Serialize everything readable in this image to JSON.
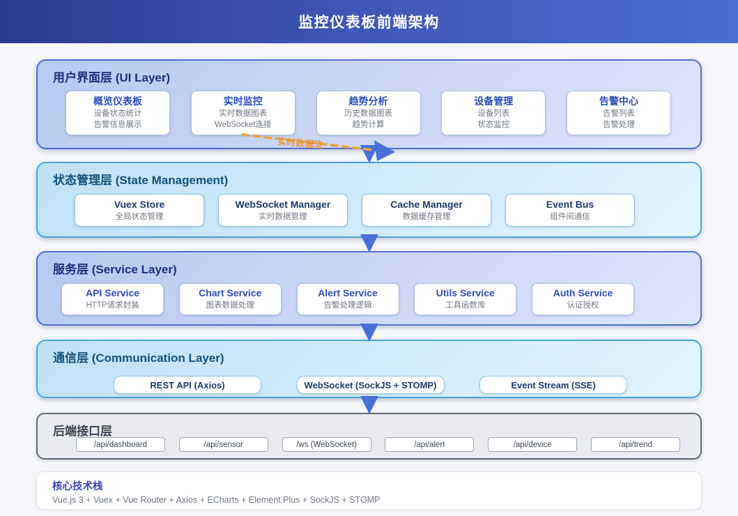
{
  "header": {
    "title": "监控仪表板前端架构"
  },
  "layers": {
    "ui": {
      "title": "用户界面层 (UI Layer)",
      "cards": [
        {
          "title": "概览仪表板",
          "lines": [
            "设备状态统计",
            "告警信息展示"
          ]
        },
        {
          "title": "实时监控",
          "lines": [
            "实时数据图表",
            "WebSocket连接"
          ]
        },
        {
          "title": "趋势分析",
          "lines": [
            "历史数据图表",
            "趋势计算"
          ]
        },
        {
          "title": "设备管理",
          "lines": [
            "设备列表",
            "状态监控"
          ]
        },
        {
          "title": "告警中心",
          "lines": [
            "告警列表",
            "告警处理"
          ]
        }
      ]
    },
    "state": {
      "title": "状态管理层 (State Management)",
      "cards": [
        {
          "title": "Vuex Store",
          "lines": [
            "全局状态管理"
          ]
        },
        {
          "title": "WebSocket Manager",
          "lines": [
            "实时数据管理"
          ]
        },
        {
          "title": "Cache Manager",
          "lines": [
            "数据缓存管理"
          ]
        },
        {
          "title": "Event Bus",
          "lines": [
            "组件间通信"
          ]
        }
      ]
    },
    "service": {
      "title": "服务层 (Service Layer)",
      "cards": [
        {
          "title": "API Service",
          "lines": [
            "HTTP请求封装"
          ]
        },
        {
          "title": "Chart Service",
          "lines": [
            "图表数据处理"
          ]
        },
        {
          "title": "Alert Service",
          "lines": [
            "告警处理逻辑"
          ]
        },
        {
          "title": "Utils Service",
          "lines": [
            "工具函数库"
          ]
        },
        {
          "title": "Auth Service",
          "lines": [
            "认证授权"
          ]
        }
      ]
    },
    "communication": {
      "title": "通信层 (Communication Layer)",
      "pills": [
        "REST API (Axios)",
        "WebSocket (SockJS + STOMP)",
        "Event Stream (SSE)"
      ]
    },
    "backend": {
      "title": "后端接口层",
      "endpoints": [
        "/api/dashboard",
        "/api/sensor",
        "/ws (WebSocket)",
        "/api/alert",
        "/api/device",
        "/api/trend"
      ]
    }
  },
  "tech_stack": {
    "title": "核心技术栈",
    "items": "Vue.js 3 + Vuex + Vue Router + Axios + ECharts + Element Plus + SockJS + STOMP"
  },
  "annotations": {
    "realtime_flow_label": "实时数据流"
  },
  "colors": {
    "header_gradient_start": "#2c3c8e",
    "header_gradient_end": "#4b6ed1",
    "blue_layer_border": "#4f6fd2",
    "cyan_layer_border": "#45a5d9",
    "gray_layer_border": "#5f6b7a",
    "arrow_blue": "#4a6fd8",
    "flow_orange": "#e8963c"
  }
}
